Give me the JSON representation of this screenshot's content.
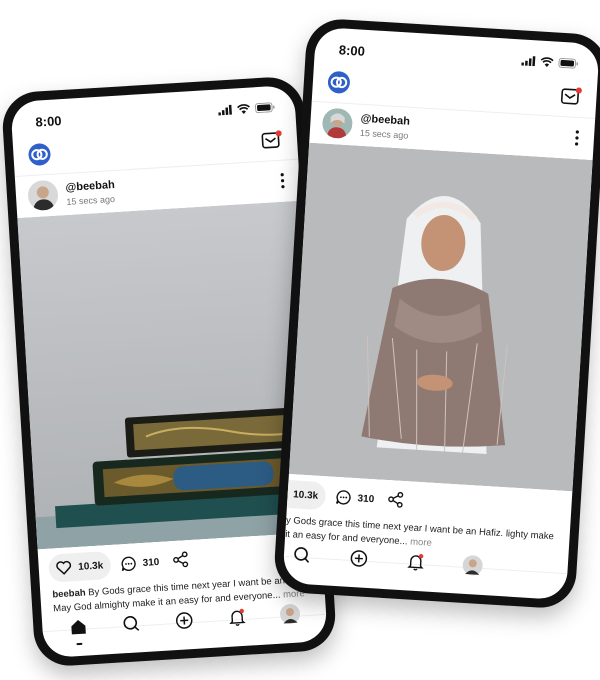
{
  "colors": {
    "brand": "#2f5fc9",
    "notify": "#e53935"
  },
  "posts": [
    {
      "time": "8:00",
      "username": "@beebah",
      "time_ago": "15 secs ago",
      "likes": "10.3k",
      "comments": "310",
      "caption_user": "beebah",
      "caption_text": " By Gods grace this time next year I want be an Hafiz. May God almighty make it an easy for and everyone... ",
      "caption_more": "more",
      "photo": "quran-books"
    },
    {
      "time": "8:00",
      "username": "@beebah",
      "time_ago": "15 secs ago",
      "likes": "10.3k",
      "comments": "310",
      "caption_text": "y Gods grace this time next year I want be an Hafiz. lighty make it an easy for and everyone... ",
      "caption_more": "more",
      "photo": "woman-in-hijab"
    }
  ],
  "nav": [
    "home-icon",
    "search-icon",
    "plus-icon",
    "bell-icon",
    "profile-avatar"
  ]
}
